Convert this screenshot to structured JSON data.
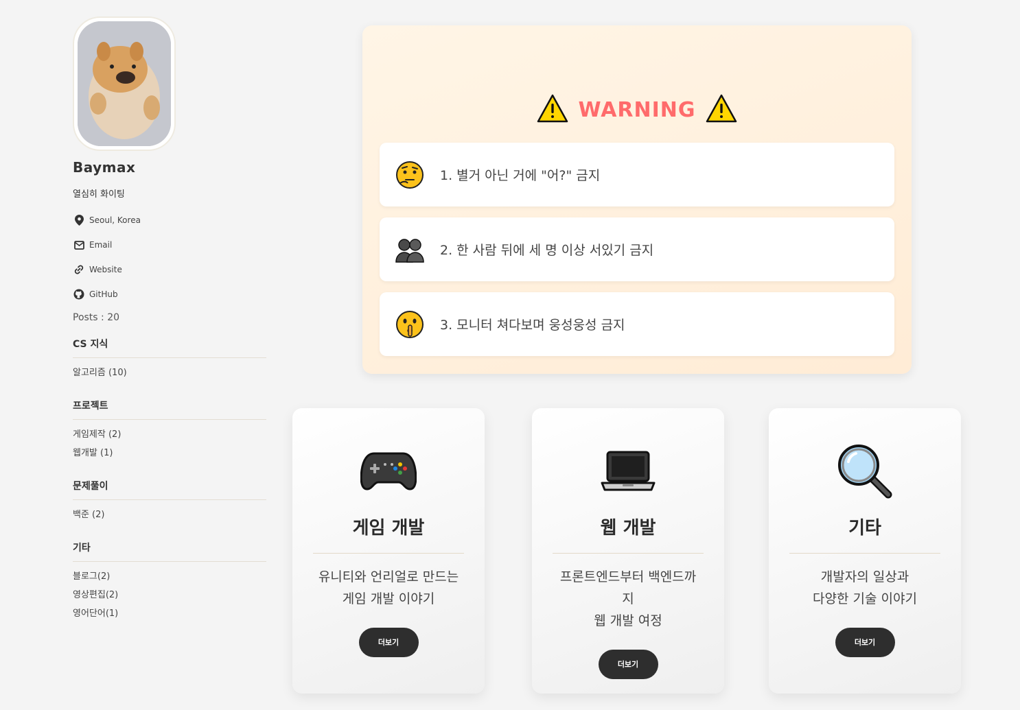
{
  "profile": {
    "name": "Baymax",
    "bio": "열심히 화이팅",
    "links": [
      {
        "label": "Seoul, Korea",
        "icon": "map-pin-icon"
      },
      {
        "label": "Email",
        "icon": "email-icon"
      },
      {
        "label": "Website",
        "icon": "link-icon"
      },
      {
        "label": "GitHub",
        "icon": "github-icon"
      }
    ],
    "posts": "Posts : 20"
  },
  "categories": [
    {
      "title": "CS 지식",
      "items": [
        "알고리즘 (10)"
      ]
    },
    {
      "title": "프로젝트",
      "items": [
        "게임제작 (2)",
        "웹개발 (1)"
      ]
    },
    {
      "title": "문제풀이",
      "items": [
        "백준 (2)"
      ]
    },
    {
      "title": "기타",
      "items": [
        "블로그(2)",
        "영상편집(2)",
        "영어단어(1)"
      ]
    }
  ],
  "warning": {
    "title": "WARNING",
    "rules": [
      {
        "text": "1. 별거 아닌 거에 \"어?\" 금지",
        "icon": "thinking-face-icon"
      },
      {
        "text": "2. 한 사람 뒤에 세 명 이상 서있기 금지",
        "icon": "people-silhouette-icon"
      },
      {
        "text": "3. 모니터 쳐다보며 웅성웅성 금지",
        "icon": "shushing-face-icon"
      }
    ]
  },
  "cards": [
    {
      "title": "게임 개발",
      "desc_lines": [
        "유니티와 언리얼로 만드는",
        "게임 개발 이야기"
      ],
      "button": "더보기",
      "icon": "gamepad-icon"
    },
    {
      "title": "웹 개발",
      "desc_lines": [
        "프론트엔드부터 백엔드까",
        "지",
        "웹 개발 여정"
      ],
      "button": "더보기",
      "icon": "laptop-icon"
    },
    {
      "title": "기타",
      "desc_lines": [
        "개발자의 일상과",
        "다양한 기술 이야기"
      ],
      "button": "더보기",
      "icon": "magnifier-icon"
    }
  ],
  "colors": {
    "warning_text": "#ff6b6b",
    "button_bg": "#2e2e2e",
    "background": "#f4f4f4"
  }
}
